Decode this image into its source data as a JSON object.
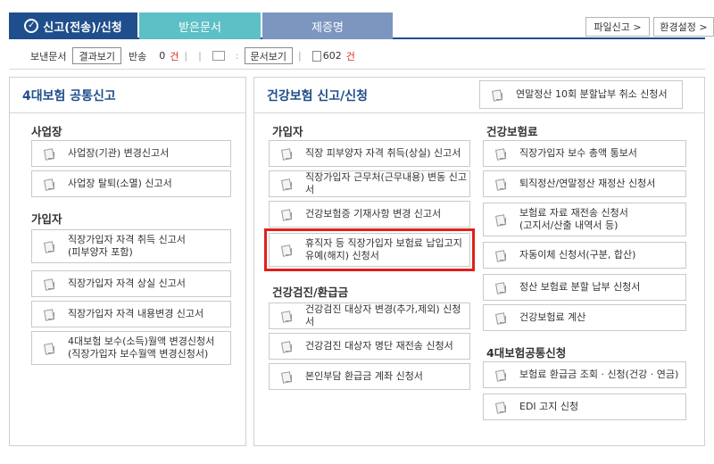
{
  "tabs": {
    "active": "신고(전송)/신청",
    "received": "받은문서",
    "certificate": "제증명"
  },
  "top_buttons": {
    "file_report": "파일신고 >",
    "env_settings": "환경설정 >"
  },
  "status": {
    "sent_label": "보낸문서",
    "result_view": "결과보기",
    "returned_label": "반송",
    "returned_count": "0",
    "unit": "건",
    "doc_view": "문서보기",
    "doc_count": "602"
  },
  "left_panel": {
    "title": "4대보험 공통신고",
    "section_workplace": "사업장",
    "workplace_items": [
      "사업장(기관) 변경신고서",
      "사업장 탈퇴(소멸) 신고서"
    ],
    "section_member": "가입자",
    "member_items": [
      [
        "직장가입자 자격 취득 신고서",
        "(피부양자 포함)"
      ],
      [
        "직장가입자 자격 상실 신고서"
      ],
      [
        "직장가입자 자격 내용변경 신고서"
      ],
      [
        "4대보험 보수(소득)월액 변경신청서",
        "(직장가입자 보수월액 변경신청서)"
      ]
    ]
  },
  "right_panel": {
    "title": "건강보험 신고/신청",
    "header_item": "연말정산 10회 분할납부 취소 신청서",
    "section_member": "가입자",
    "member_items": [
      [
        "직장 피부양자 자격 취득(상실) 신고서"
      ],
      [
        "직장가입자 근무처(근무내용) 변동 신고서"
      ],
      [
        "건강보험증 기재사항 변경 신고서"
      ],
      [
        "휴직자 등 직장가입자 보험료 납입고지",
        "유예(해지) 신청서"
      ]
    ],
    "section_checkup": "건강검진/환급금",
    "checkup_items": [
      "건강검진 대상자 변경(추가,제외) 신청서",
      "건강검진 대상자 명단 재전송 신청서",
      "본인부담 환급금 계좌 신청서"
    ],
    "section_premium": "건강보험료",
    "premium_items": [
      [
        "직장가입자 보수 총액 통보서"
      ],
      [
        "퇴직정산/연말정산 재정산 신청서"
      ],
      [
        "보험료 자료 재전송 신청서",
        "(고지서/산출 내역서 등)"
      ],
      [
        "자동이체 신청서(구분, 합산)"
      ],
      [
        "정산 보험료 분할 납부 신청서"
      ],
      [
        "건강보험료 계산"
      ]
    ],
    "section_common": "4대보험공통신청",
    "common_items": [
      "보험료 환급금 조회 · 신청(건강 · 연금)",
      "EDI 고지 신청"
    ]
  },
  "colors": {
    "navy": "#1f4e8c",
    "teal": "#5cc0c6",
    "slate": "#7c96bf",
    "highlight": "#e0201b"
  }
}
